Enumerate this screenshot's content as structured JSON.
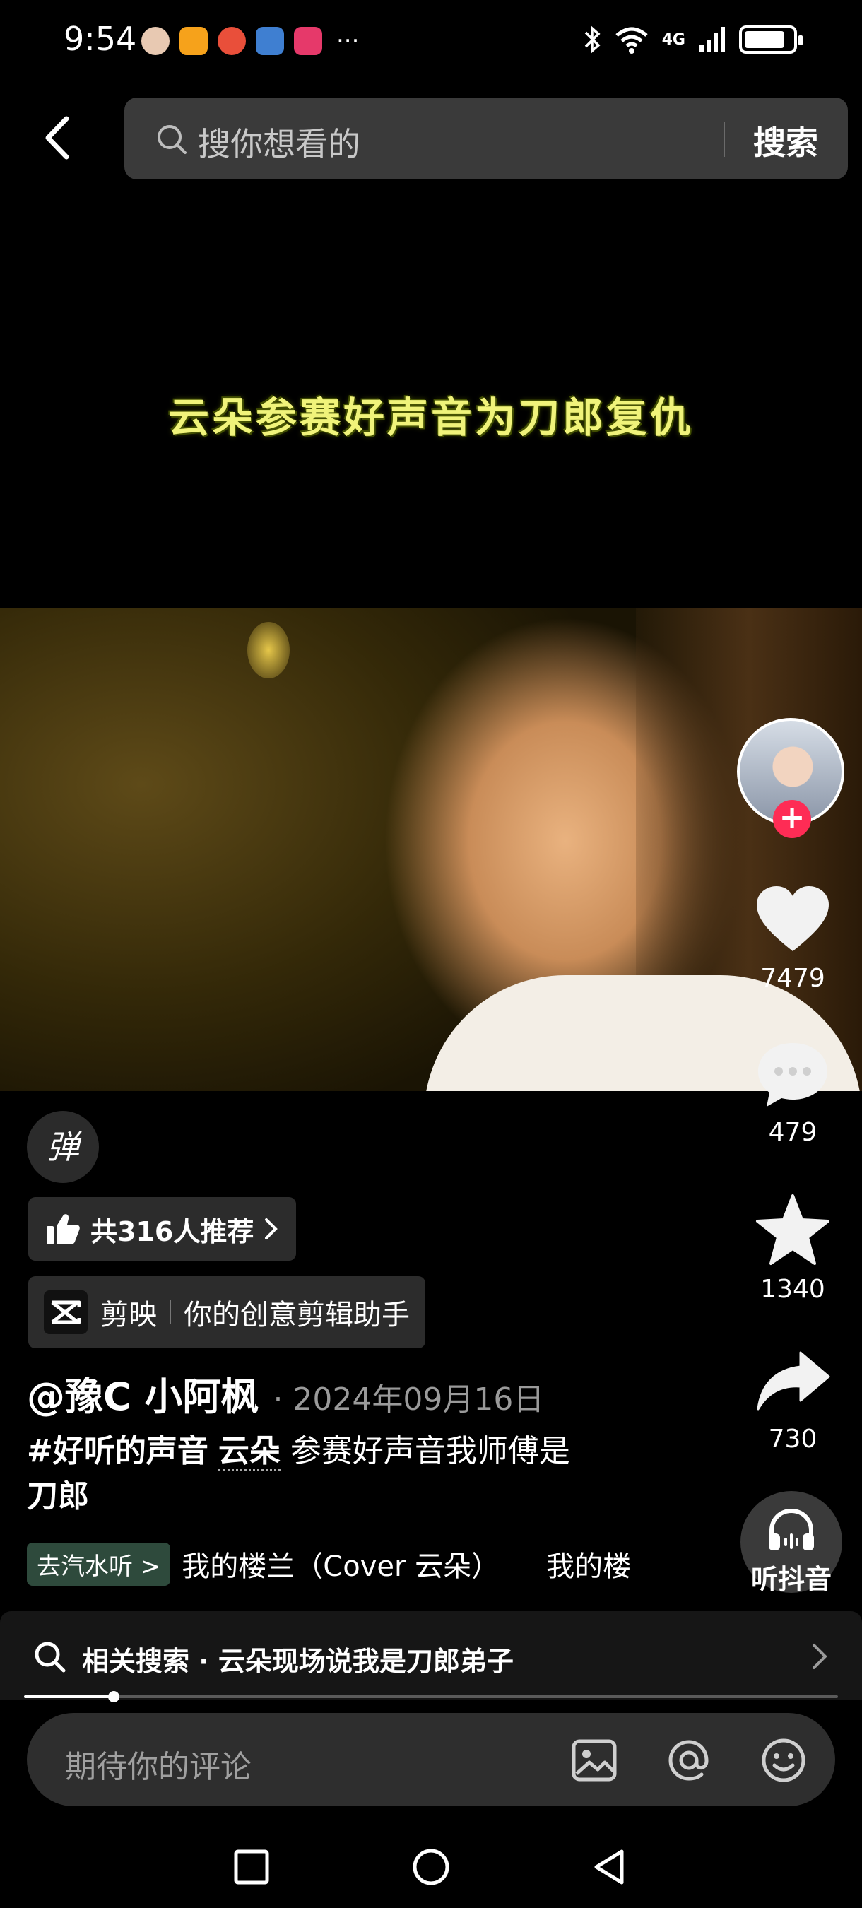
{
  "status_bar": {
    "time": "9:54",
    "network": "4G",
    "battery_level": 0.85,
    "notification_icon_colors": [
      "#e8c9b2",
      "#f6a21b",
      "#e94f3a",
      "#3f7fd1",
      "#e6396a"
    ]
  },
  "search": {
    "placeholder": "搜你想看的",
    "button_label": "搜索"
  },
  "video": {
    "caption": "云朵参赛好声音为刀郎复仇"
  },
  "rail": {
    "follow_symbol": "+",
    "like_count": "7479",
    "comment_count": "479",
    "favorite_count": "1340",
    "share_count": "730",
    "listen_label": "听抖音"
  },
  "post": {
    "danmu_label": "弹",
    "recommend_label": "共316人推荐",
    "capcut_name": "剪映",
    "capcut_slogan": "你的创意剪辑助手",
    "author": "@豫C  小阿枫",
    "date": "· 2024年09月16日",
    "hashtag": "#好听的声音",
    "mention": "云朵",
    "desc_rest": " 参赛好声音我师傅是",
    "desc_line2": "刀郎",
    "music_badge": "去汽水听 >",
    "music_title": "我的楼兰（Cover 云朵）",
    "music_title_repeat": "我的楼"
  },
  "related_search": {
    "text": "相关搜索 · 云朵现场说我是刀郎弟子"
  },
  "playback": {
    "progress": 0.11
  },
  "comment": {
    "placeholder": "期待你的评论"
  },
  "colors": {
    "accent_red": "#fe2c55",
    "caption_yellow": "#f0f37a"
  }
}
